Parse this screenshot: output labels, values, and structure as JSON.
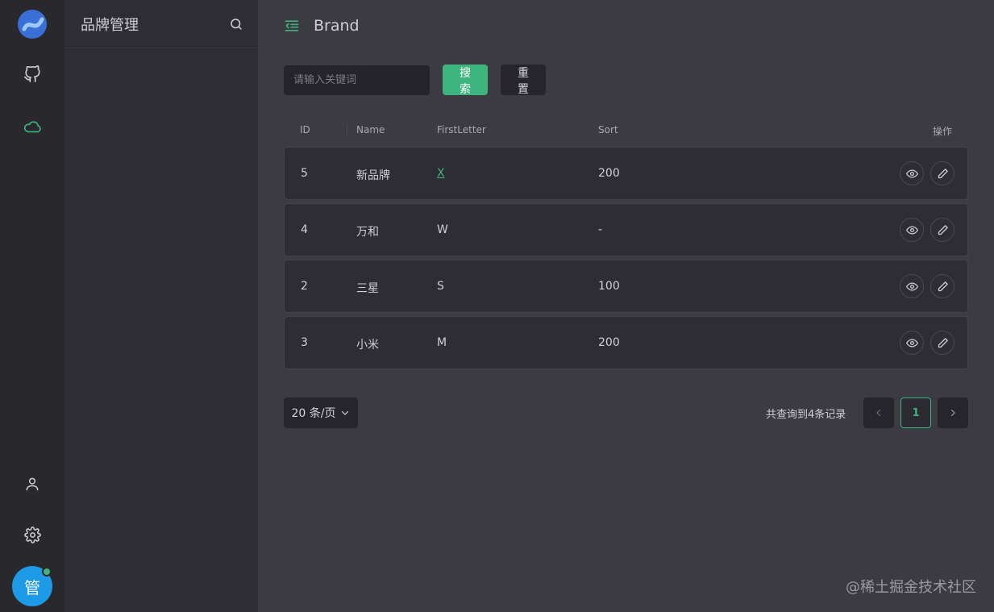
{
  "panel": {
    "title": "品牌管理"
  },
  "header": {
    "title": "Brand"
  },
  "search": {
    "placeholder": "请输入关键词",
    "search_label": "搜 索",
    "reset_label": "重 置"
  },
  "table": {
    "columns": [
      "ID",
      "Name",
      "FirstLetter",
      "Sort",
      "操作"
    ],
    "rows": [
      {
        "id": "5",
        "name": "新品牌",
        "first_letter": "X",
        "sort": "200"
      },
      {
        "id": "4",
        "name": "万和",
        "first_letter": "W",
        "sort": "-"
      },
      {
        "id": "2",
        "name": "三星",
        "first_letter": "S",
        "sort": "100"
      },
      {
        "id": "3",
        "name": "小米",
        "first_letter": "M",
        "sort": "200"
      }
    ]
  },
  "pagination": {
    "page_size_label": "20 条/页",
    "total_label": "共查询到4条记录",
    "current_page": "1"
  },
  "user": {
    "avatar_char": "管"
  },
  "watermark": "@稀土掘金技术社区",
  "colors": {
    "accent": "#3eb57e",
    "avatar": "#1d9be6",
    "background": "#3c3b42"
  }
}
